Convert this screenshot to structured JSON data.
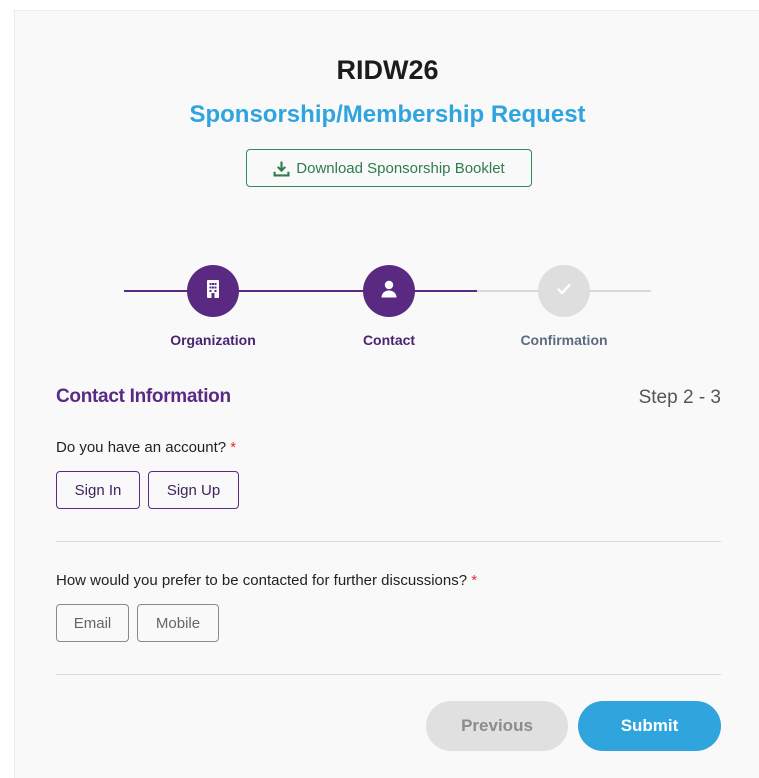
{
  "header": {
    "title": "RIDW26",
    "subtitle": "Sponsorship/Membership Request",
    "download_label": "Download Sponsorship Booklet"
  },
  "stepper": {
    "steps": [
      {
        "label": "Organization",
        "icon": "building-icon",
        "state": "completed"
      },
      {
        "label": "Contact",
        "icon": "user-icon",
        "state": "active"
      },
      {
        "label": "Confirmation",
        "icon": "check-icon",
        "state": "pending"
      }
    ]
  },
  "section": {
    "title": "Contact Information",
    "step_count": "Step 2 - 3"
  },
  "account": {
    "question": "Do you have an account?",
    "required_mark": "*",
    "options": [
      "Sign In",
      "Sign Up"
    ]
  },
  "contact_pref": {
    "question": "How would you prefer to be contacted for further discussions?",
    "required_mark": "*",
    "options": [
      "Email",
      "Mobile"
    ]
  },
  "footer": {
    "previous_label": "Previous",
    "submit_label": "Submit"
  },
  "colors": {
    "accent_purple": "#5a2a82",
    "accent_blue": "#2fa4dd",
    "download_green": "#2e8b57",
    "required_red": "#e0303a",
    "pending_grey": "#dedede"
  }
}
